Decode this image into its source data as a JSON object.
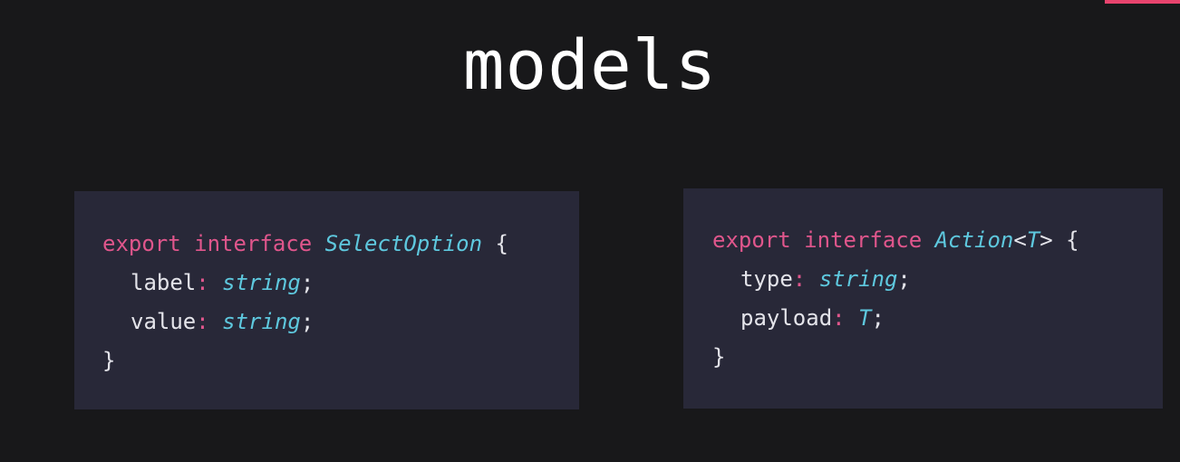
{
  "slide": {
    "title": "models"
  },
  "colors": {
    "background": "#18181a",
    "panel": "#282838",
    "keyword": "#e0568c",
    "type": "#5ec8de",
    "text": "#e4e4ea",
    "accent": "#e8446e"
  },
  "left_snippet": {
    "line1": {
      "kw_export": "export",
      "kw_interface": "interface",
      "name": "SelectOption",
      "open_brace": "{"
    },
    "line2": {
      "prop": "label",
      "colon": ":",
      "type": "string",
      "semicolon": ";"
    },
    "line3": {
      "prop": "value",
      "colon": ":",
      "type": "string",
      "semicolon": ";"
    },
    "line4": {
      "close_brace": "}"
    }
  },
  "right_snippet": {
    "line1": {
      "kw_export": "export",
      "kw_interface": "interface",
      "name": "Action",
      "generic_open": "<",
      "generic_type": "T",
      "generic_close": ">",
      "open_brace": "{"
    },
    "line2": {
      "prop": "type",
      "colon": ":",
      "type": "string",
      "semicolon": ";"
    },
    "line3": {
      "prop": "payload",
      "colon": ":",
      "type": "T",
      "semicolon": ";"
    },
    "line4": {
      "close_brace": "}"
    }
  }
}
